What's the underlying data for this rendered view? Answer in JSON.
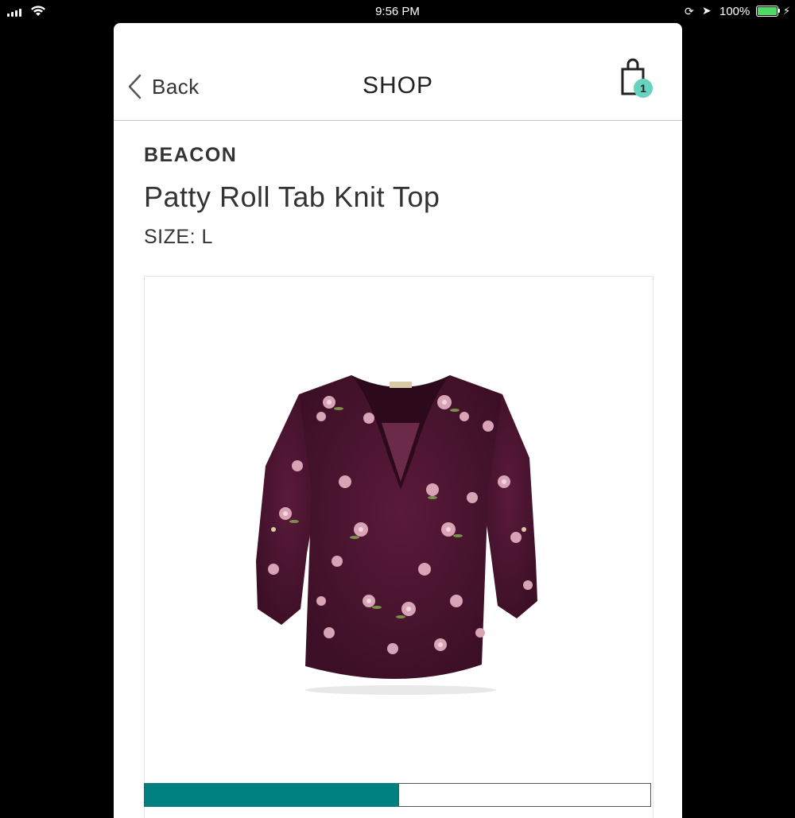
{
  "status_bar": {
    "time": "9:56 PM",
    "battery_percent": "100%",
    "battery_level": 1.0,
    "signal_bars": 4,
    "icons": [
      "signal-icon",
      "wifi-icon",
      "rotation-lock-icon",
      "location-icon",
      "battery-icon",
      "charging-icon"
    ]
  },
  "nav": {
    "back_label": "Back",
    "title": "SHOP",
    "cart_icon": "shopping-bag-icon",
    "cart_count": "1"
  },
  "product": {
    "brand": "BEACON",
    "name": "Patty Roll Tab Knit Top",
    "size_label": "SIZE: L",
    "image_description_icon": "product-image"
  },
  "colors": {
    "accent": "#007f80",
    "badge": "#66d2bf",
    "text": "#333333",
    "garment": "#4a1430"
  }
}
